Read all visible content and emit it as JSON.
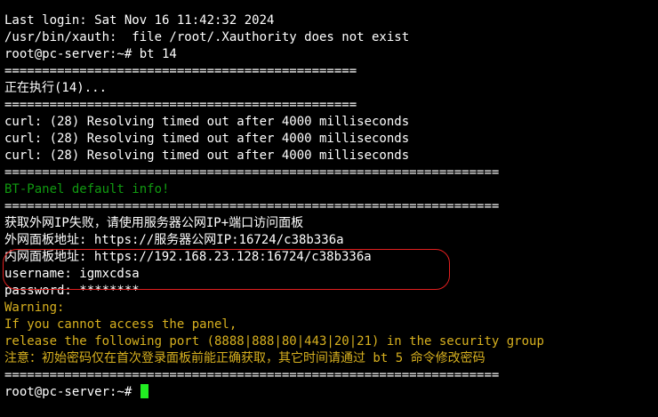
{
  "terminal": {
    "colors": {
      "background": "#000000",
      "text": "#ffffff",
      "info_green": "#119a11",
      "warning_yellow": "#d7b01f",
      "cursor": "#22ee22",
      "annotation_red": "#e21f1f"
    },
    "lines": [
      {
        "text": "Last login: Sat Nov 16 11:42:32 2024",
        "style": "normal"
      },
      {
        "text": "/usr/bin/xauth:  file /root/.Xauthority does not exist",
        "style": "normal"
      },
      {
        "text": "root@pc-server:~# bt 14",
        "style": "normal"
      },
      {
        "text": "===============================================",
        "style": "normal"
      },
      {
        "text": "正在执行(14)...",
        "style": "normal"
      },
      {
        "text": "===============================================",
        "style": "normal"
      },
      {
        "text": "curl: (28) Resolving timed out after 4000 milliseconds",
        "style": "normal"
      },
      {
        "text": "curl: (28) Resolving timed out after 4000 milliseconds",
        "style": "normal"
      },
      {
        "text": "curl: (28) Resolving timed out after 4000 milliseconds",
        "style": "normal"
      },
      {
        "text": "==================================================================",
        "style": "normal"
      },
      {
        "text": "BT-Panel default info!",
        "style": "green"
      },
      {
        "text": "==================================================================",
        "style": "normal"
      },
      {
        "text": "获取外网IP失败，请使用服务器公网IP+端口访问面板",
        "style": "normal"
      },
      {
        "text": "外网面板地址: https://服务器公网IP:16724/c38b336a",
        "style": "normal"
      },
      {
        "text": "内网面板地址: https://192.168.23.128:16724/c38b336a",
        "style": "normal"
      },
      {
        "text": "username: igmxcdsa",
        "style": "normal"
      },
      {
        "text": "password: ********",
        "style": "normal"
      },
      {
        "text": "Warning:",
        "style": "yellow"
      },
      {
        "text": "If you cannot access the panel,",
        "style": "yellow"
      },
      {
        "text": "release the following port (8888|888|80|443|20|21) in the security group",
        "style": "yellow"
      },
      {
        "text": "注意：初始密码仅在首次登录面板前能正确获取，其它时间请通过 bt 5 命令修改密码",
        "style": "yellow"
      },
      {
        "text": "==================================================================",
        "style": "normal"
      }
    ],
    "prompt": "root@pc-server:~# "
  }
}
